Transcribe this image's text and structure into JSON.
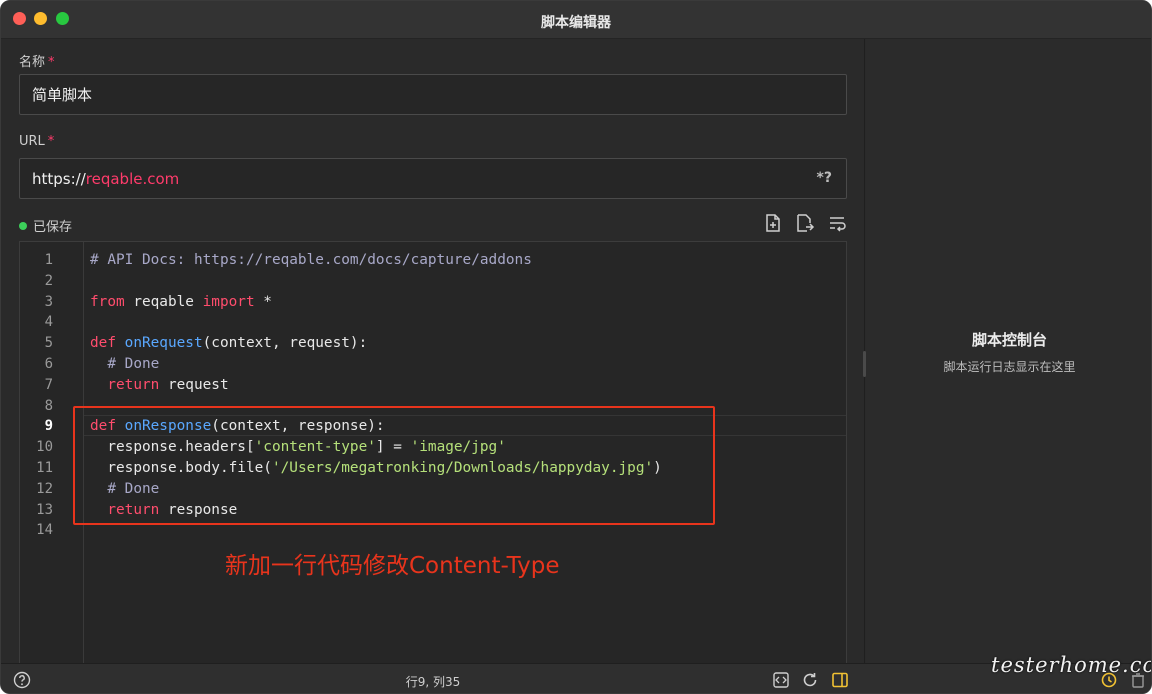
{
  "window": {
    "title": "脚本编辑器"
  },
  "form": {
    "name_label": "名称",
    "name_required": "*",
    "name_value": "简单脚本",
    "url_label": "URL",
    "url_required": "*",
    "url_scheme": "https://",
    "url_host": "reqable.com",
    "url_suffix": "*?"
  },
  "status": {
    "saved_text": "已保存",
    "color": "#3ccf5a"
  },
  "toolbar": {
    "icons": [
      "file-add-icon",
      "file-export-icon",
      "wrap-lines-icon"
    ]
  },
  "editor": {
    "active_line": 9,
    "line_numbers": [
      "1",
      "2",
      "3",
      "4",
      "5",
      "6",
      "7",
      "8",
      "9",
      "10",
      "11",
      "12",
      "13",
      "14"
    ],
    "lines": [
      [
        {
          "t": "# API Docs: https://reqable.com/docs/capture/addons",
          "c": "comment"
        }
      ],
      [],
      [
        {
          "t": "from",
          "c": "kw"
        },
        {
          "t": " reqable ",
          "c": "plain"
        },
        {
          "t": "import",
          "c": "kw"
        },
        {
          "t": " *",
          "c": "plain"
        }
      ],
      [],
      [
        {
          "t": "def ",
          "c": "kw"
        },
        {
          "t": "onRequest",
          "c": "fn"
        },
        {
          "t": "(context, request):",
          "c": "plain"
        }
      ],
      [
        {
          "t": "  # Done",
          "c": "comment"
        }
      ],
      [
        {
          "t": "  ",
          "c": "plain"
        },
        {
          "t": "return",
          "c": "kw"
        },
        {
          "t": " request",
          "c": "plain"
        }
      ],
      [],
      [
        {
          "t": "def ",
          "c": "kw"
        },
        {
          "t": "onResponse",
          "c": "fn"
        },
        {
          "t": "(context, response):",
          "c": "plain"
        }
      ],
      [
        {
          "t": "  response.headers[",
          "c": "plain"
        },
        {
          "t": "'content-type'",
          "c": "str"
        },
        {
          "t": "] = ",
          "c": "plain"
        },
        {
          "t": "'image/jpg'",
          "c": "str"
        }
      ],
      [
        {
          "t": "  response.body.file(",
          "c": "plain"
        },
        {
          "t": "'/Users/megatronking/Downloads/happyday.jpg'",
          "c": "str"
        },
        {
          "t": ")",
          "c": "plain"
        }
      ],
      [
        {
          "t": "  # Done",
          "c": "comment"
        }
      ],
      [
        {
          "t": "  ",
          "c": "plain"
        },
        {
          "t": "return",
          "c": "kw"
        },
        {
          "t": " response",
          "c": "plain"
        }
      ],
      []
    ]
  },
  "annotation": {
    "text": "新加一行代码修改Content-Type",
    "color": "#e8341c"
  },
  "console": {
    "title": "脚本控制台",
    "subtitle": "脚本运行日志显示在这里"
  },
  "statusbar": {
    "cursor_position": "行9, 列35"
  },
  "watermark": {
    "text": "testerhome.com"
  }
}
